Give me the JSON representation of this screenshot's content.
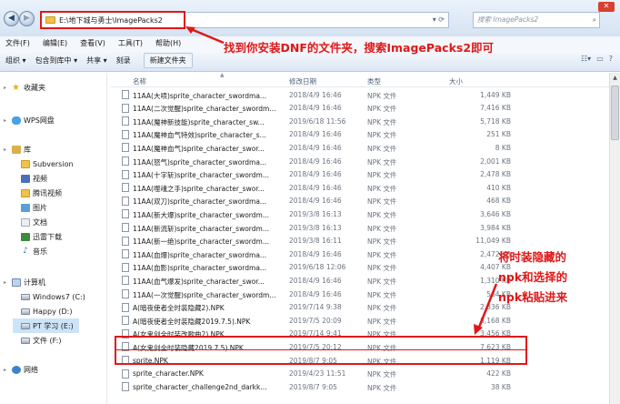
{
  "address_bar": {
    "path": "E:\\地下城与勇士\\ImagePacks2",
    "search_placeholder": "搜索 ImagePacks2"
  },
  "menu": [
    "文件(F)",
    "编辑(E)",
    "查看(V)",
    "工具(T)",
    "帮助(H)"
  ],
  "toolbar": {
    "organize": "组织 ▾",
    "include": "包含到库中 ▾",
    "share": "共享 ▾",
    "burn": "刻录",
    "new_folder": "新建文件夹"
  },
  "annotations": {
    "top": "找到你安装DNF的文件夹，搜索ImagePacks2即可",
    "side_lines": [
      "将时装隐藏的",
      "npk和选择的",
      "npk粘贴进来"
    ]
  },
  "sidebar": [
    {
      "label": "收藏夹",
      "icon": "star-icon",
      "kind": "star",
      "level": 0
    },
    {
      "label": "WPS网盘",
      "icon": "cloud-icon",
      "kind": "cloud",
      "level": 0
    },
    {
      "label": "库",
      "icon": "library-icon",
      "kind": "lib",
      "level": 0
    },
    {
      "label": "Subversion",
      "icon": "folder-icon",
      "kind": "folder",
      "level": 1
    },
    {
      "label": "视频",
      "icon": "video-icon",
      "kind": "video",
      "level": 1
    },
    {
      "label": "腾讯视频",
      "icon": "folder-icon",
      "kind": "folder",
      "level": 1
    },
    {
      "label": "图片",
      "icon": "picture-icon",
      "kind": "pic",
      "level": 1
    },
    {
      "label": "文档",
      "icon": "document-icon",
      "kind": "doc",
      "level": 1
    },
    {
      "label": "迅雷下载",
      "icon": "download-icon",
      "kind": "dl",
      "level": 1
    },
    {
      "label": "音乐",
      "icon": "music-icon",
      "kind": "music",
      "level": 1
    },
    {
      "label": "计算机",
      "icon": "computer-icon",
      "kind": "pc",
      "level": 0
    },
    {
      "label": "Windows7 (C:)",
      "icon": "drive-icon",
      "kind": "drive",
      "level": 1
    },
    {
      "label": "Happy (D:)",
      "icon": "drive-icon",
      "kind": "drive",
      "level": 1
    },
    {
      "label": "PT 学习 (E:)",
      "icon": "drive-icon",
      "kind": "drive",
      "level": 1,
      "selected": true
    },
    {
      "label": "文件 (F:)",
      "icon": "drive-icon",
      "kind": "drive",
      "level": 1
    },
    {
      "label": "网络",
      "icon": "network-icon",
      "kind": "net",
      "level": 0
    }
  ],
  "columns": {
    "name": "名称",
    "date": "修改日期",
    "type": "类型",
    "size": "大小"
  },
  "files": [
    {
      "name": "11AA(大喷)sprite_character_swordma...",
      "date": "2018/4/9 16:46",
      "type": "NPK 文件",
      "size": "1,449 KB"
    },
    {
      "name": "11AA(二次觉醒)sprite_character_swordm...",
      "date": "2018/4/9 16:46",
      "type": "NPK 文件",
      "size": "7,416 KB"
    },
    {
      "name": "11AA(魔神新技能)sprite_character_sw...",
      "date": "2019/6/18 11:56",
      "type": "NPK 文件",
      "size": "5,718 KB"
    },
    {
      "name": "11AA(魔神血气特效)sprite_character_s...",
      "date": "2018/4/9 16:46",
      "type": "NPK 文件",
      "size": "251 KB"
    },
    {
      "name": "11AA(魔神血气)sprite_character_swor...",
      "date": "2018/4/9 16:46",
      "type": "NPK 文件",
      "size": "8 KB"
    },
    {
      "name": "11AA(怒气)sprite_character_swordma...",
      "date": "2018/4/9 16:46",
      "type": "NPK 文件",
      "size": "2,001 KB"
    },
    {
      "name": "11AA(十字斩)sprite_character_swordm...",
      "date": "2018/4/9 16:46",
      "type": "NPK 文件",
      "size": "2,478 KB"
    },
    {
      "name": "11AA(噬魂之手)sprite_character_swor...",
      "date": "2018/4/9 16:46",
      "type": "NPK 文件",
      "size": "410 KB"
    },
    {
      "name": "11AA(双刀)sprite_character_swordma...",
      "date": "2018/4/9 16:46",
      "type": "NPK 文件",
      "size": "468 KB"
    },
    {
      "name": "11AA(新大爆)sprite_character_swordm...",
      "date": "2019/3/8 16:13",
      "type": "NPK 文件",
      "size": "3,646 KB"
    },
    {
      "name": "11AA(新流斩)sprite_character_swordm...",
      "date": "2019/3/8 16:13",
      "type": "NPK 文件",
      "size": "3,984 KB"
    },
    {
      "name": "11AA(新一绝)sprite_character_swordm...",
      "date": "2019/3/8 16:11",
      "type": "NPK 文件",
      "size": "11,049 KB"
    },
    {
      "name": "11AA(血爆)sprite_character_swordma...",
      "date": "2018/4/9 16:46",
      "type": "NPK 文件",
      "size": "2,472 KB"
    },
    {
      "name": "11AA(血影)sprite_character_swordma...",
      "date": "2019/6/18 12:06",
      "type": "NPK 文件",
      "size": "4,407 KB"
    },
    {
      "name": "11AA(血气爆发)sprite_character_swor...",
      "date": "2018/4/9 16:46",
      "type": "NPK 文件",
      "size": "1,310 KB"
    },
    {
      "name": "11AA(一次觉醒)sprite_character_swordm...",
      "date": "2018/4/9 16:46",
      "type": "NPK 文件",
      "size": "564 KB"
    },
    {
      "name": "A(暗夜使者全时装隐藏2).NPK",
      "date": "2019/7/14 9:38",
      "type": "NPK 文件",
      "size": "2,336 KB"
    },
    {
      "name": "A(暗夜使者全时装隐藏2019.7.5).NPK",
      "date": "2019/7/5 20:09",
      "type": "NPK 文件",
      "size": "8,168 KB"
    },
    {
      "name": "A(女鬼剑全时装改歌曲2).NPK",
      "date": "2019/7/14 9:41",
      "type": "NPK 文件",
      "size": "3,456 KB"
    },
    {
      "name": "A(女鬼剑全时装隐藏2019.7.5).NPK",
      "date": "2019/7/5 20:12",
      "type": "NPK 文件",
      "size": "7,623 KB"
    },
    {
      "name": "sprite.NPK",
      "date": "2019/8/7 9:05",
      "type": "NPK 文件",
      "size": "1,119 KB"
    },
    {
      "name": "sprite_character.NPK",
      "date": "2019/4/23 11:51",
      "type": "NPK 文件",
      "size": "422 KB"
    },
    {
      "name": "sprite_character_challenge2nd_darkk...",
      "date": "2019/8/7 9:05",
      "type": "NPK 文件",
      "size": "38 KB"
    }
  ]
}
